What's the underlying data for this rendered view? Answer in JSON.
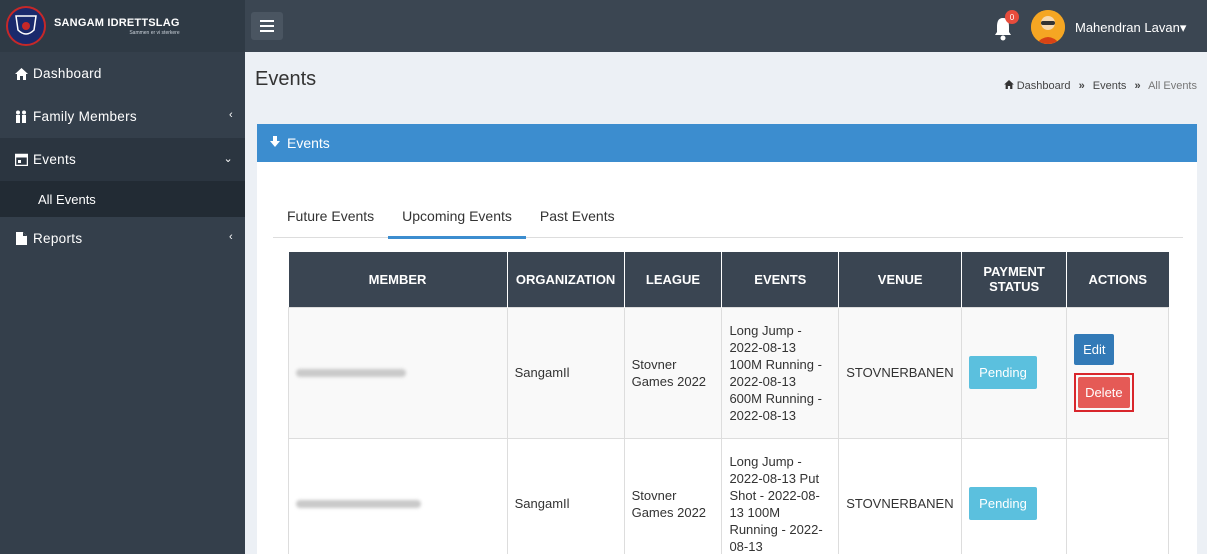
{
  "brand": {
    "name": "SANGAM IDRETTSLAG",
    "tagline": "Sammen er vi sterkere",
    "logo_text": "SANGAM"
  },
  "header": {
    "notification_count": "0",
    "user_name": "Mahendran Lavan",
    "caret": "▾"
  },
  "sidebar": {
    "items": [
      {
        "label": "Dashboard"
      },
      {
        "label": "Family Members",
        "chevron": "‹"
      },
      {
        "label": "Events",
        "chevron": "⌄"
      },
      {
        "label": "Reports",
        "chevron": "‹"
      }
    ],
    "sub_items": [
      {
        "label": "All Events"
      }
    ]
  },
  "page": {
    "title": "Events",
    "breadcrumb": [
      "Dashboard",
      "Events",
      "All Events"
    ],
    "breadcrumb_sep": "»"
  },
  "box": {
    "title": "Events"
  },
  "tabs": [
    {
      "label": "Future Events"
    },
    {
      "label": "Upcoming Events",
      "active": true
    },
    {
      "label": "Past Events"
    }
  ],
  "table": {
    "headers": [
      "MEMBER",
      "ORGANIZATION",
      "LEAGUE",
      "EVENTS",
      "VENUE",
      "PAYMENT STATUS",
      "ACTIONS"
    ],
    "rows": [
      {
        "organization": "SangamIl",
        "league": "Stovner Games 2022",
        "events": "Long Jump - 2022-08-13 100M Running - 2022-08-13 600M Running - 2022-08-13",
        "venue": "STOVNERBANEN",
        "status": "Pending",
        "edit": "Edit",
        "delete": "Delete"
      },
      {
        "organization": "SangamIl",
        "league": "Stovner Games 2022",
        "events": "Long Jump - 2022-08-13 Put Shot - 2022-08-13 100M Running - 2022-08-13",
        "venue": "STOVNERBANEN",
        "status": "Pending"
      }
    ]
  },
  "colors": {
    "sidebar": "#343f4b",
    "navbar": "#3b4652",
    "accent": "#3c8dcf",
    "pending": "#5bc0de",
    "danger": "#e55a56",
    "edit": "#337ab7"
  }
}
